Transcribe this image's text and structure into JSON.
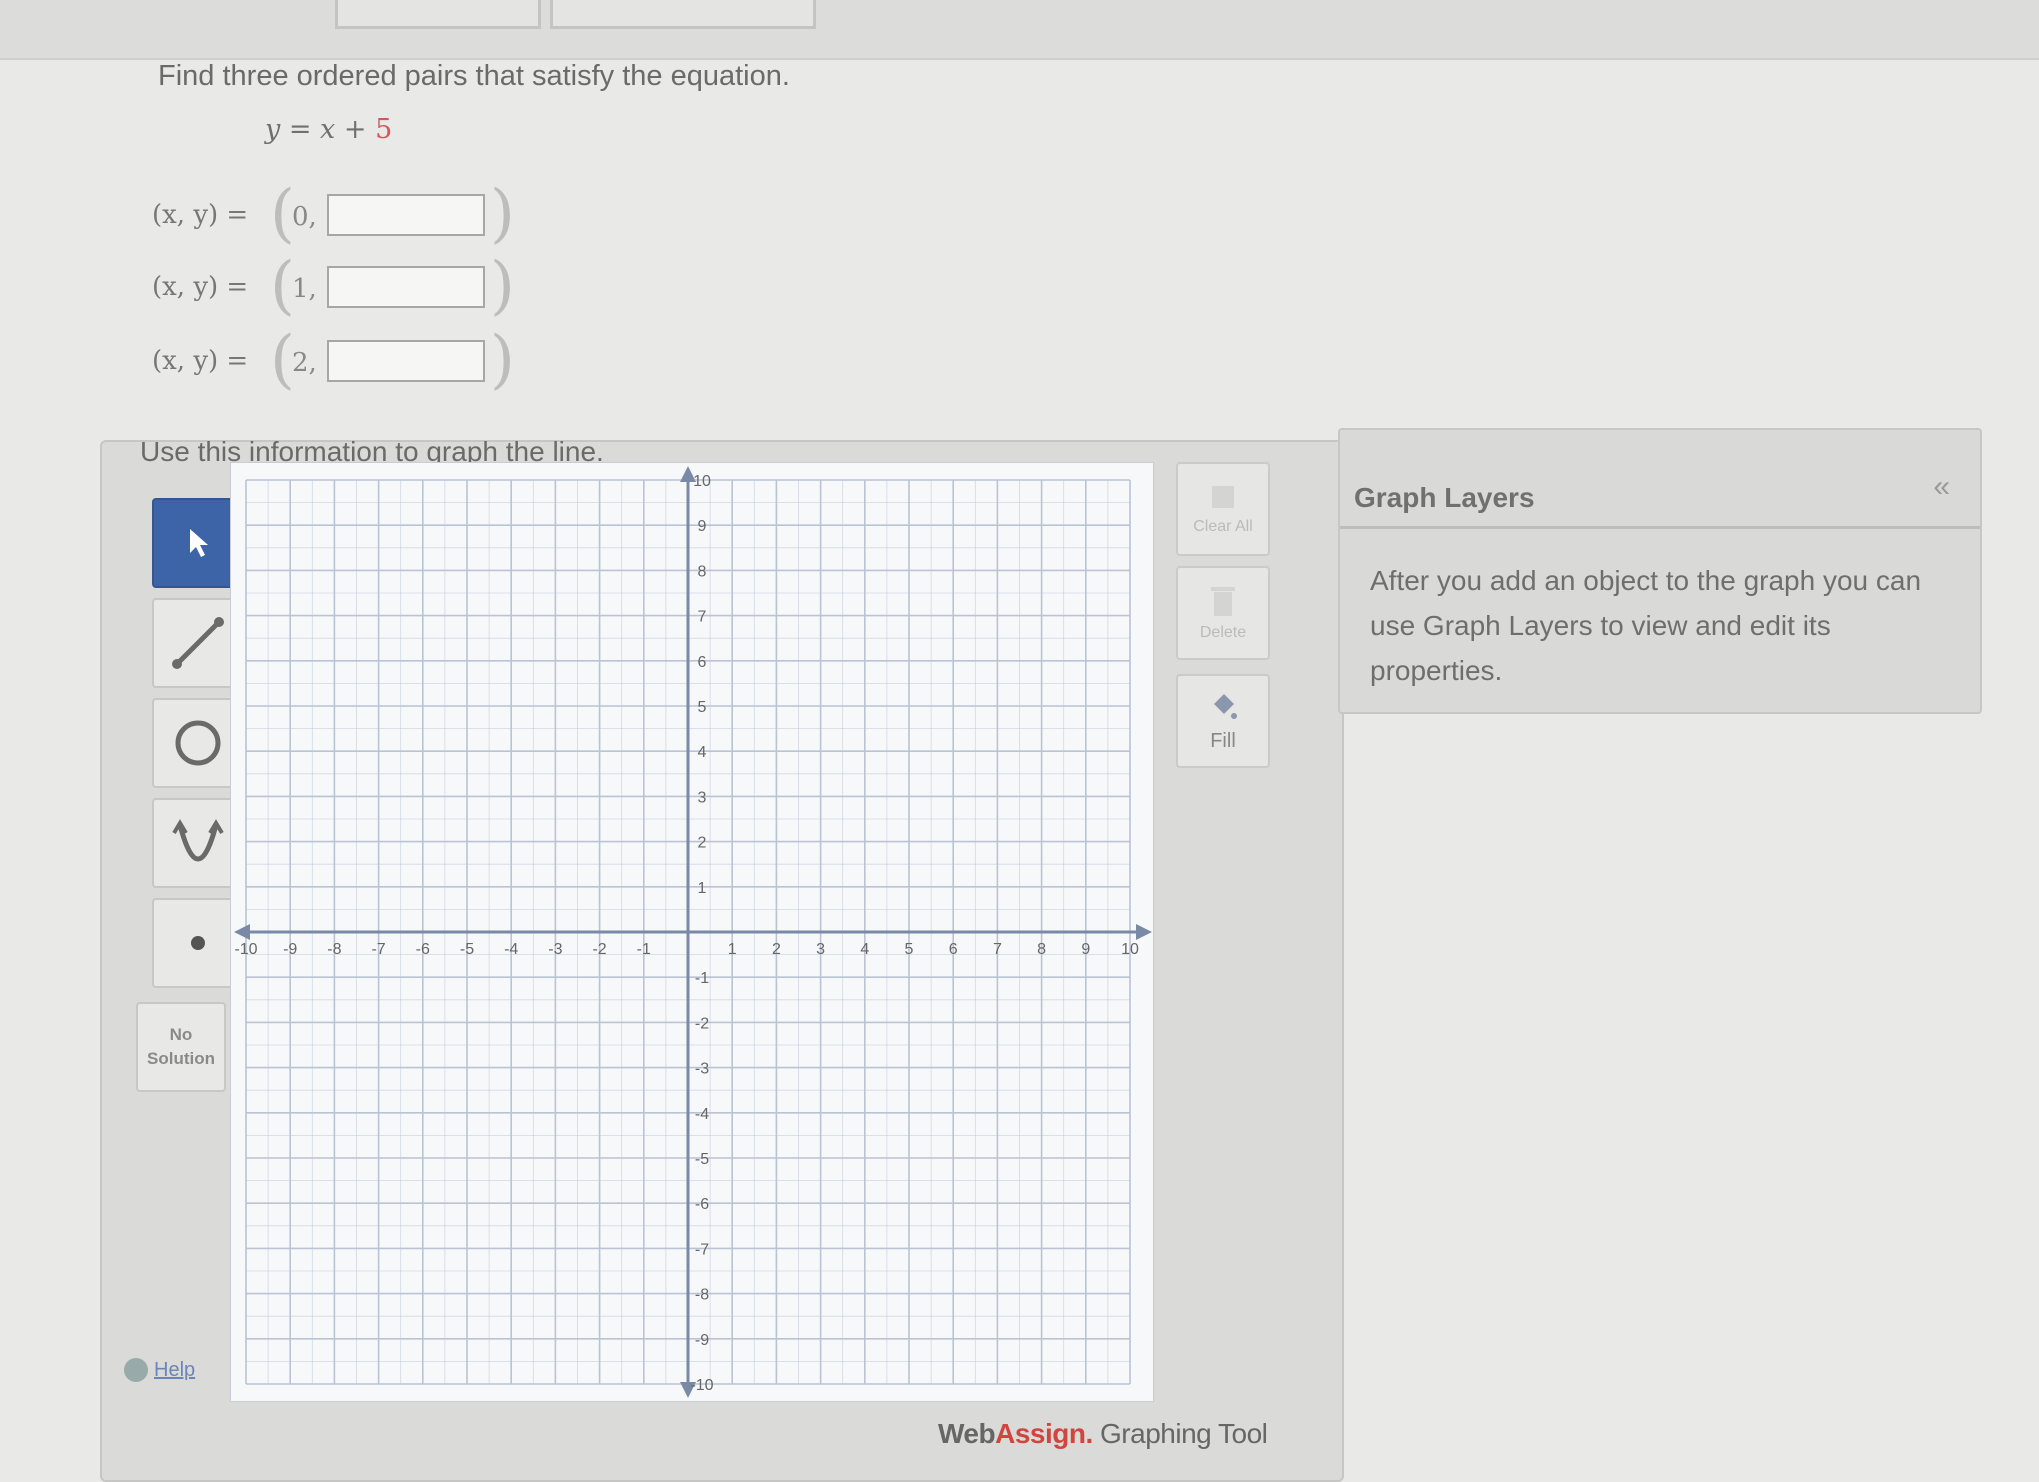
{
  "question": {
    "prompt": "Find three ordered pairs that satisfy the equation.",
    "equation_lhs": "y = x +",
    "equation_const": "5",
    "pairs": [
      {
        "label": "(x, y) =",
        "x": "0,",
        "value": ""
      },
      {
        "label": "(x, y) =",
        "x": "1,",
        "value": ""
      },
      {
        "label": "(x, y) =",
        "x": "2,",
        "value": ""
      }
    ],
    "graph_instruction": "Use this information to graph the line."
  },
  "tools": {
    "items": [
      {
        "name": "pointer-tool",
        "icon": "pointer-arrow-icon"
      },
      {
        "name": "line-tool",
        "icon": "line-segment-icon"
      },
      {
        "name": "circle-tool",
        "icon": "circle-icon"
      },
      {
        "name": "parabola-tool",
        "icon": "parabola-icon"
      },
      {
        "name": "point-tool",
        "icon": "point-dot-icon"
      }
    ],
    "no_solution_line1": "No",
    "no_solution_line2": "Solution",
    "help_label": "Help"
  },
  "graph": {
    "x_range": [
      -10,
      10
    ],
    "y_range": [
      -10,
      10
    ],
    "x_ticks": [
      "-10",
      "-9",
      "-8",
      "-7",
      "-6",
      "-5",
      "-4",
      "-3",
      "-2",
      "-1",
      "1",
      "2",
      "3",
      "4",
      "5",
      "6",
      "7",
      "8",
      "9",
      "10"
    ],
    "y_ticks": [
      "10",
      "9",
      "8",
      "7",
      "6",
      "5",
      "4",
      "3",
      "2",
      "1",
      "-1",
      "-2",
      "-3",
      "-4",
      "-5",
      "-6",
      "-7",
      "-8",
      "-9",
      "-10"
    ],
    "grid": true
  },
  "side_actions": {
    "clear_all_label": "Clear All",
    "delete_label": "Delete",
    "fill_label": "Fill"
  },
  "brand": {
    "web": "Web",
    "assign": "Assign.",
    "rest": "Graphing Tool"
  },
  "layers": {
    "title": "Graph Layers",
    "collapse_icon": "double-chevron-left-icon",
    "message": "After you add an object to the graph you can use Graph Layers to view and edit its properties."
  },
  "colors": {
    "active_tool": "#3e64a8",
    "accent_red": "#d0463e",
    "grid_line": "#b9c3d4"
  }
}
